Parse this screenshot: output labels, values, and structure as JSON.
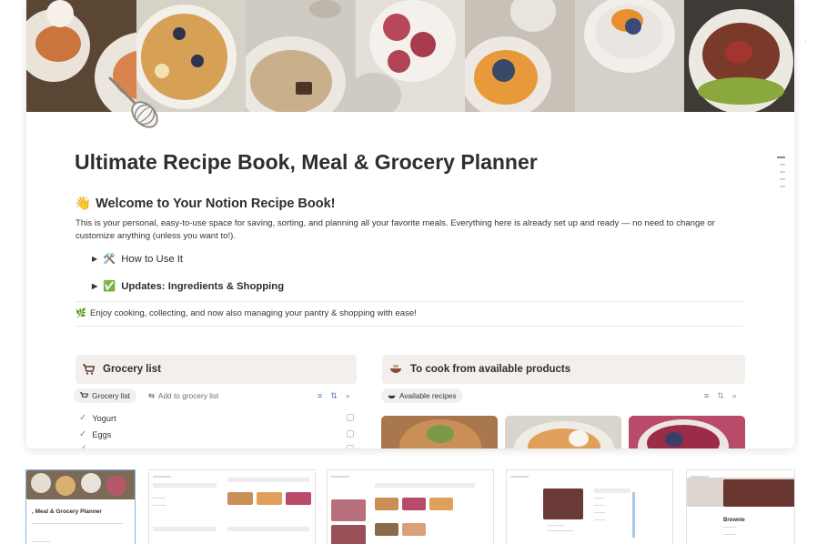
{
  "page": {
    "title": "Ultimate Recipe Book, Meal & Grocery Planner",
    "welcome_emoji": "👋",
    "welcome_heading": "Welcome to Your Notion Recipe Book!",
    "intro": "This is your personal, easy-to-use space for saving, sorting, and planning all your favorite meals. Everything here is already set up and ready — no need to change or customize anything (unless you want to!).",
    "toggles": [
      {
        "emoji": "🛠️",
        "label": "How to Use It"
      },
      {
        "emoji": "✅",
        "label": "Updates: Ingredients & Shopping"
      }
    ],
    "callout_emoji": "🌿",
    "callout": "Enjoy cooking, collecting, and now also managing your pantry & shopping with ease!"
  },
  "grocery": {
    "title": "Grocery list",
    "views": [
      "Grocery list",
      "Add to grocery list"
    ],
    "items": [
      "Yogurt",
      "Eggs"
    ]
  },
  "cook": {
    "title": "To cook from available products",
    "view": "Available recipes"
  },
  "thumbnails": {
    "first_caption": ", Meal & Grocery Planner",
    "last_caption": "Brownie"
  },
  "colors": {
    "accent_blue": "#5a7fb5",
    "panel_bg": "#f3efed",
    "check_green": "#6f9a55"
  },
  "icons": [
    "wave-emoji",
    "tools-emoji",
    "check-emoji",
    "herb-emoji",
    "cart-icon",
    "bowl-icon",
    "filter-icon",
    "sort-icon",
    "search-icon",
    "whisk-icon"
  ]
}
